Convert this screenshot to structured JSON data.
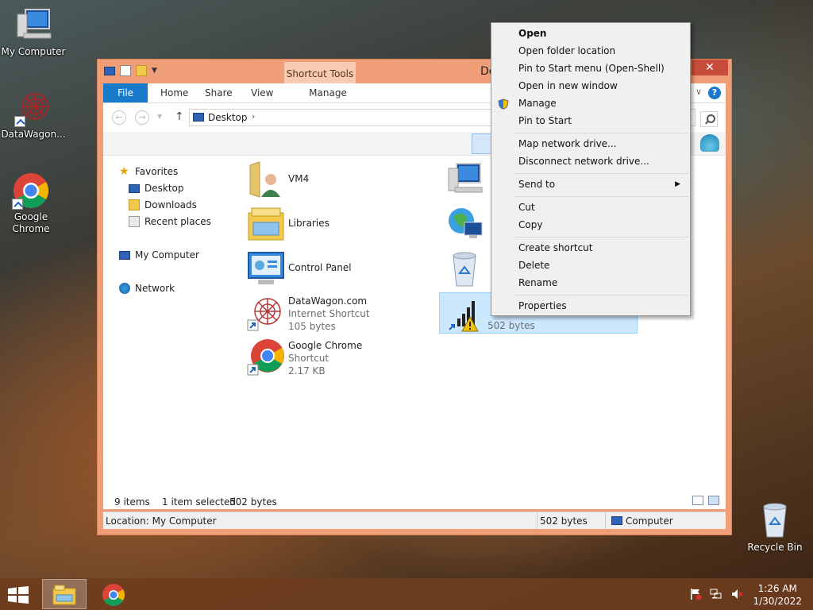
{
  "desktop": {
    "icons": [
      {
        "label": "My Computer"
      },
      {
        "label": "DataWagon..."
      },
      {
        "label": "Google Chrome"
      }
    ],
    "recycle_bin": "Recycle Bin"
  },
  "window": {
    "title": "De",
    "contextual_tab_group": "Shortcut Tools",
    "tabs": {
      "file": "File",
      "home": "Home",
      "share": "Share",
      "view": "View",
      "manage": "Manage"
    },
    "address": {
      "location": "Desktop"
    },
    "nav_pane": {
      "favorites": "Favorites",
      "desktop": "Desktop",
      "downloads": "Downloads",
      "recent": "Recent places",
      "computer": "My Computer",
      "network": "Network"
    },
    "files": [
      {
        "name": "VM4"
      },
      {
        "name": "Libraries"
      },
      {
        "name": "Control Panel"
      },
      {
        "name": "DataWagon.com",
        "type": "Internet Shortcut",
        "size": "105 bytes"
      },
      {
        "name": "Google Chrome",
        "type": "Shortcut",
        "size": "2.17 KB"
      }
    ],
    "selected_item": {
      "size": "502 bytes"
    },
    "status": {
      "items": "9 items",
      "selected": "1 item selected",
      "size": "502 bytes"
    },
    "details": {
      "location": "Location: My Computer",
      "size": "502 bytes",
      "zone": "Computer"
    }
  },
  "context_menu": {
    "open": "Open",
    "open_folder": "Open folder location",
    "pin_start_menu": "Pin to Start menu (Open-Shell)",
    "open_new_window": "Open in new window",
    "manage": "Manage",
    "pin_start": "Pin to Start",
    "map_drive": "Map network drive...",
    "disconnect_drive": "Disconnect network drive...",
    "send_to": "Send to",
    "cut": "Cut",
    "copy": "Copy",
    "create_shortcut": "Create shortcut",
    "delete": "Delete",
    "rename": "Rename",
    "properties": "Properties"
  },
  "taskbar": {
    "time": "1:26 AM",
    "date": "1/30/2022"
  },
  "colors": {
    "accent": "#1979ca",
    "window_frame": "#ef9e77",
    "selection": "#cce8ff"
  }
}
